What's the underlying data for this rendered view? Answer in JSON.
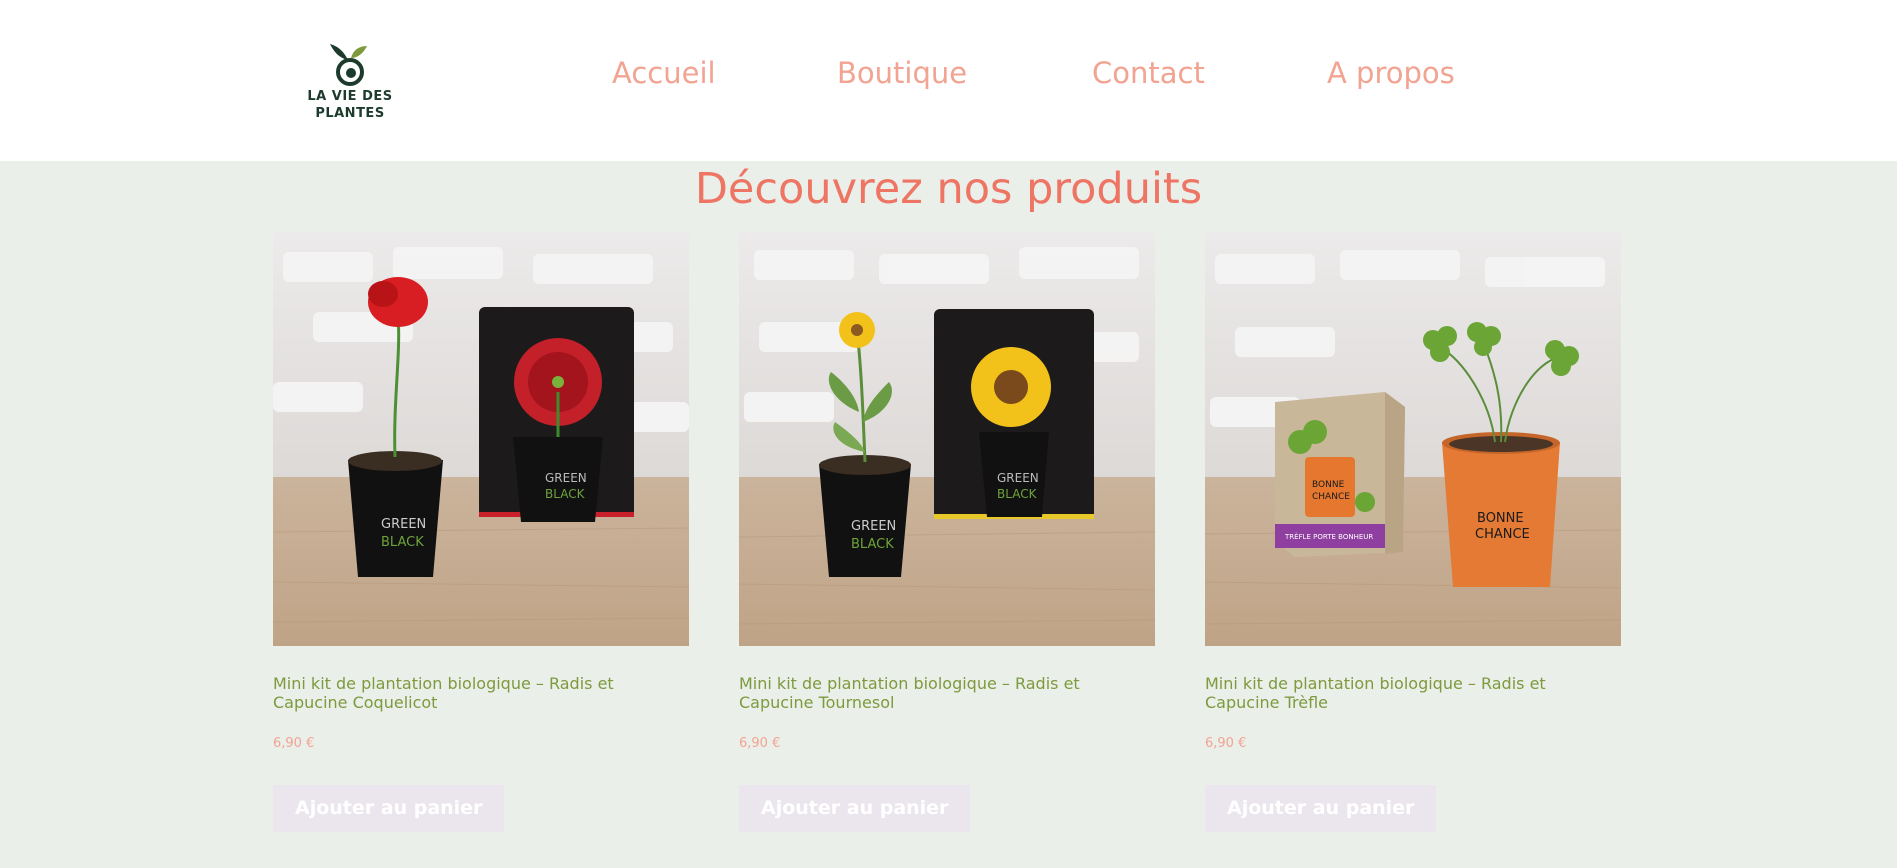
{
  "brand": {
    "name_line1": "LA VIE DES",
    "name_line2": "PLANTES",
    "logo_icon": "sprout-spiral-icon",
    "color": "#1d3b2c",
    "leaf_color": "#7d9a3c"
  },
  "nav": {
    "items": [
      {
        "label": "Accueil"
      },
      {
        "label": "Boutique"
      },
      {
        "label": "Contact"
      },
      {
        "label": "A propos"
      }
    ],
    "color": "#f2a391"
  },
  "main": {
    "title": "Découvrez nos produits",
    "title_color": "#ee7563",
    "products": [
      {
        "title": "Mini kit de plantation biologique – Radis et Capucine Coquelicot",
        "price": "6,90 €",
        "button": "Ajouter au panier",
        "image": "poppy-kit-photo",
        "flower_color": "#d81e22"
      },
      {
        "title": "Mini kit de plantation biologique – Radis et Capucine Tournesol",
        "price": "6,90 €",
        "button": "Ajouter au panier",
        "image": "sunflower-kit-photo",
        "flower_color": "#f2c21a"
      },
      {
        "title": "Mini kit de plantation biologique – Radis et Capucine Trèfle",
        "price": "6,90 €",
        "button": "Ajouter au panier",
        "image": "clover-kit-photo",
        "flower_color": "#6aa536"
      }
    ]
  },
  "colors": {
    "background": "#eaefea",
    "header": "#ffffff",
    "product_title": "#7d9a3c",
    "price": "#f2a391",
    "button_bg": "#ebe6ee"
  }
}
